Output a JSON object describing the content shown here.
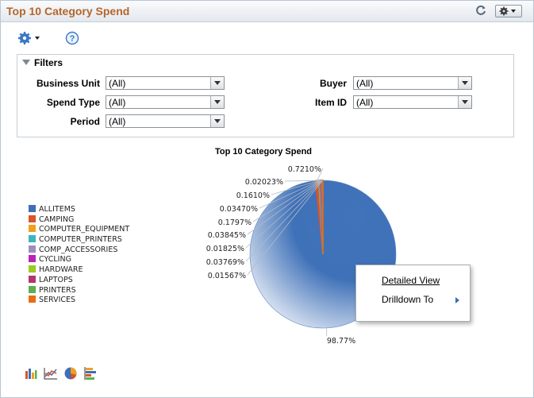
{
  "header": {
    "title": "Top 10 Category Spend",
    "refresh_icon": "refresh-icon",
    "options_icon": "gear-icon"
  },
  "toolbar": {
    "settings_icon": "gear-icon",
    "help_icon": "help-icon"
  },
  "filters": {
    "title": "Filters",
    "fields": [
      {
        "label": "Business Unit",
        "value": "(All)"
      },
      {
        "label": "Spend Type",
        "value": "(All)"
      },
      {
        "label": "Period",
        "value": "(All)"
      },
      {
        "label": "Buyer",
        "value": "(All)"
      },
      {
        "label": "Item ID",
        "value": "(All)"
      }
    ]
  },
  "chart_data": {
    "type": "pie",
    "title": "Top 10 Category Spend",
    "legend_placement": "left",
    "categories": [
      "ALLITEMS",
      "CAMPING",
      "COMPUTER_EQUIPMENT",
      "COMPUTER_PRINTERS",
      "COMP_ACCESSORIES",
      "CYCLING",
      "HARDWARE",
      "LAPTOPS",
      "PRINTERS",
      "SERVICES"
    ],
    "colors": [
      "#3e6fb5",
      "#d9542a",
      "#f0a01d",
      "#3bb5bf",
      "#9a8ec2",
      "#bb24b5",
      "#9ccb21",
      "#b4366c",
      "#5bb04f",
      "#e96d15"
    ],
    "slice_labels": [
      "98.77%",
      "0.7210%",
      "0.02023%",
      "0.1610%",
      "0.03470%",
      "0.1797%",
      "0.03845%",
      "0.01825%",
      "0.03769%",
      "0.01567%"
    ],
    "values": [
      98.77,
      0.721,
      0.02023,
      0.161,
      0.0347,
      0.1797,
      0.03845,
      0.01825,
      0.03769,
      0.01567
    ]
  },
  "context_menu": {
    "items": [
      "Detailed View",
      "Drilldown To"
    ]
  },
  "chart_type_icons": [
    "bar-chart-icon",
    "line-chart-icon",
    "pie-chart-icon",
    "horizontal-bar-chart-icon"
  ]
}
